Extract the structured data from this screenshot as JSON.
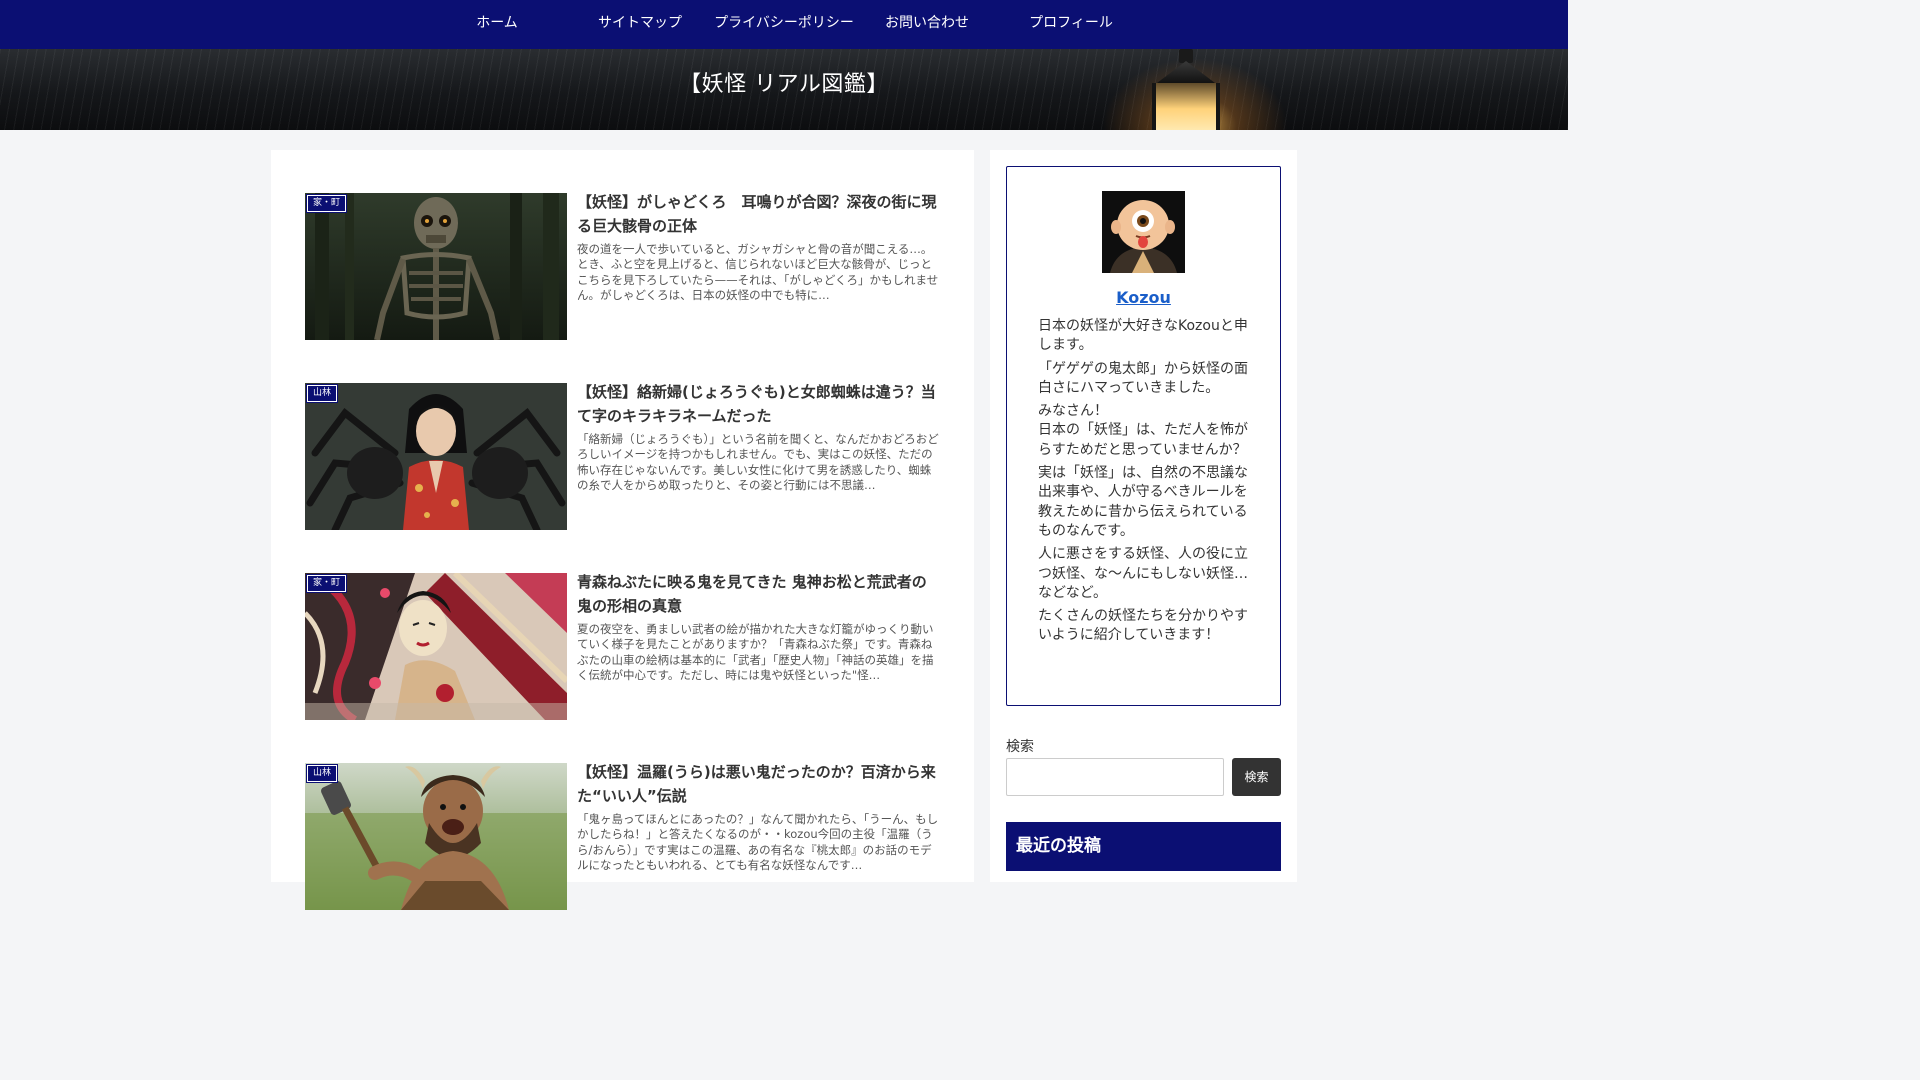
{
  "nav": {
    "items": [
      {
        "label": "ホーム"
      },
      {
        "label": "サイトマップ"
      },
      {
        "label": "プライバシーポリシー"
      },
      {
        "label": "お問い合わせ"
      },
      {
        "label": "プロフィール"
      }
    ]
  },
  "header": {
    "site_title": "【妖怪 リアル図鑑】"
  },
  "posts": [
    {
      "category": "家・町",
      "title": "【妖怪】がしゃどくろ　耳鳴りが合図？深夜の街に現る巨大骸骨の正体",
      "excerpt": "夜の道を一人で歩いていると、ガシャガシャと骨の音が聞こえる…。とき、ふと空を見上げると、信じられないほど巨大な骸骨が、じっとこちらを見下ろしていたら——それは、「がしゃどくろ」かもしれません。がしゃどくろは、日本の妖怪の中でも特に…",
      "image": "giant-skeleton-forest"
    },
    {
      "category": "山林",
      "title": "【妖怪】絡新婦(じょろうぐも)と女郎蜘蛛は違う？当て字のキラキラネームだった",
      "excerpt": "「絡新婦（じょろうぐも）」という名前を聞くと、なんだかおどろおどろしいイメージを持つかもしれません。でも、実はこの妖怪、ただの怖い存在じゃないんです。美しい女性に化けて男を誘惑したり、蜘蛛の糸で人をからめ取ったりと、その姿と行動には不思議…",
      "image": "woman-kimono-spider"
    },
    {
      "category": "家・町",
      "title": "青森ねぶたに映る鬼を見てきた 鬼神お松と荒武者の鬼の形相の真意",
      "excerpt": "夏の夜空を、勇ましい武者の絵が描かれた大きな灯籠がゆっくり動いていく様子を見たことがありますか？「青森ねぶた祭」です。青森ねぶたの山車の絵柄は基本的に「武者」「歴史人物」「神話の英雄」を描く伝統が中心です。ただし、時には鬼や妖怪といった\"怪…",
      "image": "nebuta-lantern"
    },
    {
      "category": "山林",
      "title": "【妖怪】温羅(うら)は悪い鬼だったのか？百済から来た“いい人”伝説",
      "excerpt": "「鬼ヶ島ってほんとにあったの？」なんて聞かれたら、「うーん、もしかしたらね！」と答えたくなるのが・・kozou今回の主役「温羅（うら/おんら）」です実はこの温羅、あの有名な『桃太郎』のお話のモデルになったともいわれる、とても有名な妖怪なんです…",
      "image": "horned-oni-hammer"
    }
  ],
  "profile": {
    "name": "Kozou",
    "avatar": "one-eyed-monk-avatar",
    "paragraphs": [
      "日本の妖怪が大好きなKozouと申します。",
      "「ゲゲゲの鬼太郎」から妖怪の面白さにハマっていきました。",
      "みなさん！\n日本の「妖怪」は、ただ人を怖がらすためだと思っていませんか？",
      "実は「妖怪」は、自然の不思議な出来事や、人が守るべきルールを教えために昔から伝えられているものなんです。",
      "人に悪さをする妖怪、人の役に立つ妖怪、な～んにもしない妖怪…などなど。",
      "たくさんの妖怪たちを分かりやすいように紹介していきます！"
    ]
  },
  "search": {
    "label": "検索",
    "value": "",
    "button_label": "検索"
  },
  "recent": {
    "heading": "最近の投稿"
  },
  "colors": {
    "brand_navy": "#0b0f73",
    "link_blue": "#1a5ec9",
    "button_dark": "#333333"
  }
}
